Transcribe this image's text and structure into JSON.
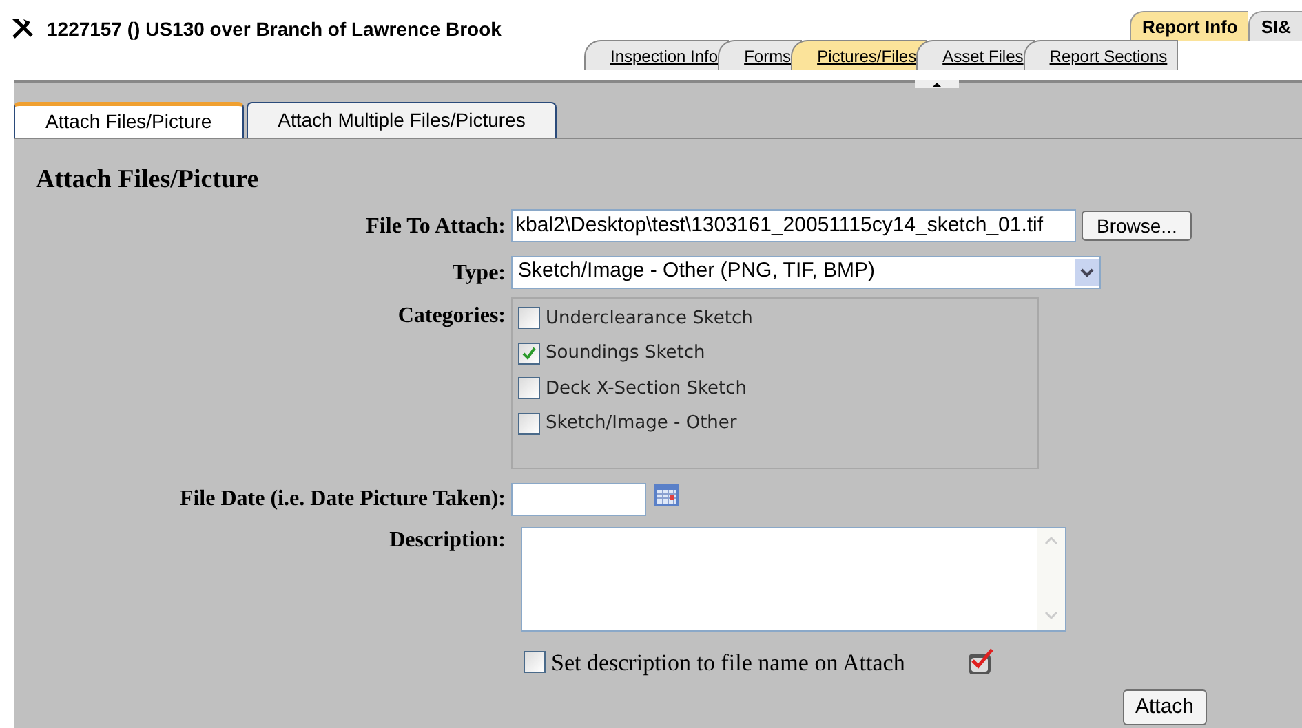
{
  "header": {
    "title": "1227157 () US130 over Branch of Lawrence Brook"
  },
  "top_tabs": [
    {
      "label": "Report Info",
      "selected": true
    },
    {
      "label": "SI&",
      "selected": false
    }
  ],
  "sub_tabs": [
    {
      "label": "Inspection Info",
      "selected": false
    },
    {
      "label": "Forms",
      "selected": false
    },
    {
      "label": "Pictures/Files",
      "selected": true
    },
    {
      "label": "Asset Files",
      "selected": false
    },
    {
      "label": "Report Sections",
      "selected": false
    }
  ],
  "panel_tabs": [
    {
      "label": "Attach Files/Picture",
      "selected": true
    },
    {
      "label": "Attach Multiple Files/Pictures",
      "selected": false
    }
  ],
  "form": {
    "title": "Attach Files/Picture",
    "file_label": "File To Attach:",
    "file_value": "kbal2\\Desktop\\test\\1303161_20051115cy14_sketch_01.tif",
    "browse": "Browse...",
    "type_label": "Type:",
    "type_value": "Sketch/Image - Other (PNG, TIF, BMP)",
    "categories_label": "Categories:",
    "categories": [
      {
        "label": "Underclearance Sketch",
        "checked": false
      },
      {
        "label": "Soundings Sketch",
        "checked": true
      },
      {
        "label": "Deck X-Section Sketch",
        "checked": false
      },
      {
        "label": "Sketch/Image - Other",
        "checked": false
      }
    ],
    "date_label": "File Date (i.e. Date Picture Taken):",
    "description_label": "Description:",
    "set_description": {
      "label": "Set description to file name on Attach",
      "checked": false
    },
    "attach": "Attach"
  }
}
